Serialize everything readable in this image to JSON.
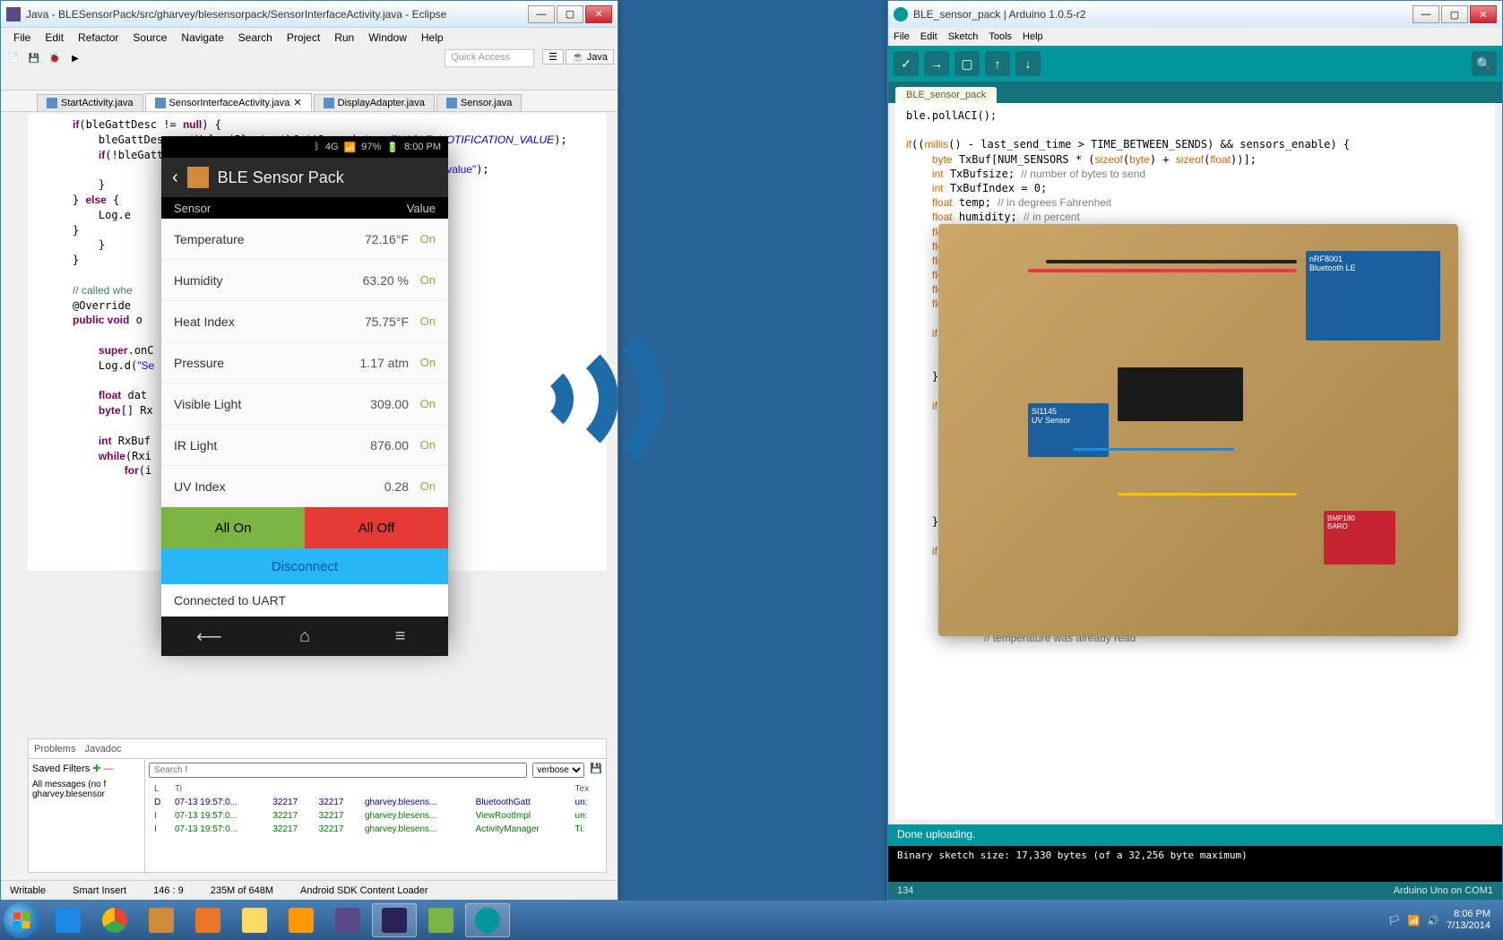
{
  "eclipse": {
    "title": "Java - BLESensorPack/src/gharvey/blesensorpack/SensorInterfaceActivity.java - Eclipse",
    "menu": [
      "File",
      "Edit",
      "Refactor",
      "Source",
      "Navigate",
      "Search",
      "Project",
      "Run",
      "Window",
      "Help"
    ],
    "quick_access": "Quick Access",
    "perspective_java": "Java",
    "tabs": [
      {
        "label": "StartActivity.java",
        "active": false
      },
      {
        "label": "SensorInterfaceActivity.java",
        "active": true
      },
      {
        "label": "DisplayAdapter.java",
        "active": false
      },
      {
        "label": "Sensor.java",
        "active": false
      }
    ],
    "bottom_tabs": [
      "Problems",
      "Javadoc"
    ],
    "saved_filters": "Saved Filters",
    "all_messages": "All messages (no f",
    "filter_src": "gharvey.blesensor",
    "search": "Search f",
    "verbose": "verbose",
    "log_headers": [
      "L",
      "Ti",
      "",
      "",
      "",
      "",
      "Tex"
    ],
    "logs": [
      {
        "lvl": "D",
        "time": "07-13 19:57:0...",
        "p1": "32217",
        "p2": "32217",
        "app": "gharvey.blesens...",
        "tag": "BluetoothGatt",
        "msg": "un:"
      },
      {
        "lvl": "I",
        "time": "07-13 19:57:0...",
        "p1": "32217",
        "p2": "32217",
        "app": "gharvey.blesens...",
        "tag": "ViewRootImpl",
        "msg": "un:"
      },
      {
        "lvl": "I",
        "time": "07-13 19:57:0...",
        "p1": "32217",
        "p2": "32217",
        "app": "gharvey.blesens...",
        "tag": "ActivityManager",
        "msg": "Ti:"
      }
    ],
    "status": {
      "writable": "Writable",
      "insert": "Smart Insert",
      "pos": "146 : 9",
      "mem": "235M of 648M",
      "task": "Android SDK Content Loader"
    }
  },
  "arduino": {
    "title": "BLE_sensor_pack | Arduino 1.0.5-r2",
    "menu": [
      "File",
      "Edit",
      "Sketch",
      "Tools",
      "Help"
    ],
    "tab": "BLE_sensor_pack",
    "status": "Done uploading.",
    "console": "Binary sketch size: 17,330 bytes (of a 32,256 byte maximum)",
    "footer_left": "134",
    "footer_right": "Arduino Uno on COM1"
  },
  "board": {
    "bt_label": "nRF8001\nBluetooth LE",
    "uv_label": "SI1145\nUV Sensor",
    "baro_label": "BMP180\nBARO"
  },
  "phone": {
    "carrier": "4G",
    "battery": "97%",
    "time": "8:00 PM",
    "app_title": "BLE Sensor Pack",
    "col_sensor": "Sensor",
    "col_value": "Value",
    "sensors": [
      {
        "name": "Temperature",
        "value": "72.16°F",
        "on": "On"
      },
      {
        "name": "Humidity",
        "value": "63.20 %",
        "on": "On"
      },
      {
        "name": "Heat Index",
        "value": "75.75°F",
        "on": "On"
      },
      {
        "name": "Pressure",
        "value": "1.17 atm",
        "on": "On"
      },
      {
        "name": "Visible Light",
        "value": "309.00",
        "on": "On"
      },
      {
        "name": "IR Light",
        "value": "876.00",
        "on": "On"
      },
      {
        "name": "UV Index",
        "value": "0.28",
        "on": "On"
      }
    ],
    "all_on": "All On",
    "all_off": "All Off",
    "disconnect": "Disconnect",
    "conn_status": "Connected to UART"
  },
  "taskbar": {
    "time": "8:06 PM",
    "date": "7/13/2014"
  }
}
